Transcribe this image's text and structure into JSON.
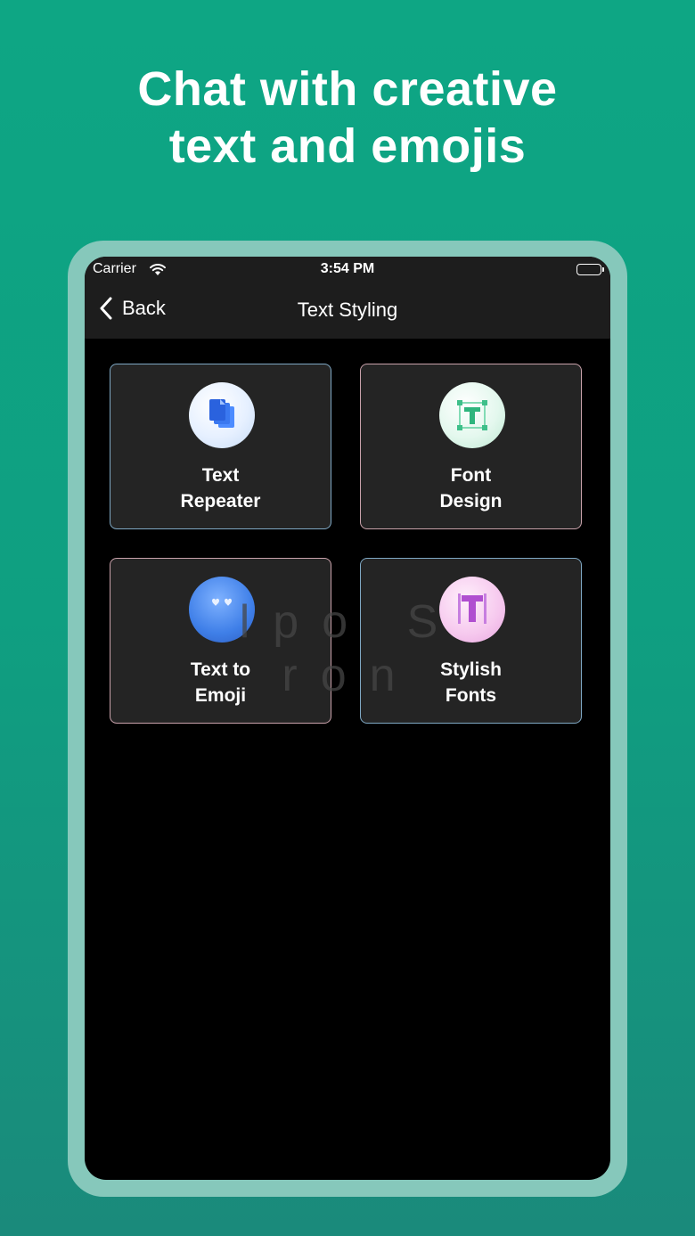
{
  "headline": {
    "line1": "Chat with creative",
    "line2": "text and emojis"
  },
  "status_bar": {
    "carrier": "Carrier",
    "time": "3:54 PM"
  },
  "nav": {
    "back_label": "Back",
    "title": "Text Styling"
  },
  "cards": [
    {
      "line1": "Text",
      "line2": "Repeater",
      "icon": "copy-pages-icon"
    },
    {
      "line1": "Font",
      "line2": "Design",
      "icon": "font-design-icon"
    },
    {
      "line1": "Text to",
      "line2": "Emoji",
      "icon": "heart-eyes-emoji-icon"
    },
    {
      "line1": "Stylish",
      "line2": "Fonts",
      "icon": "stylish-t-icon"
    }
  ],
  "watermark": "lpo S ron",
  "colors": {
    "background": "#0ea684",
    "frame": "#86c8bb",
    "card": "#242424",
    "topbar": "#1d1d1d"
  }
}
